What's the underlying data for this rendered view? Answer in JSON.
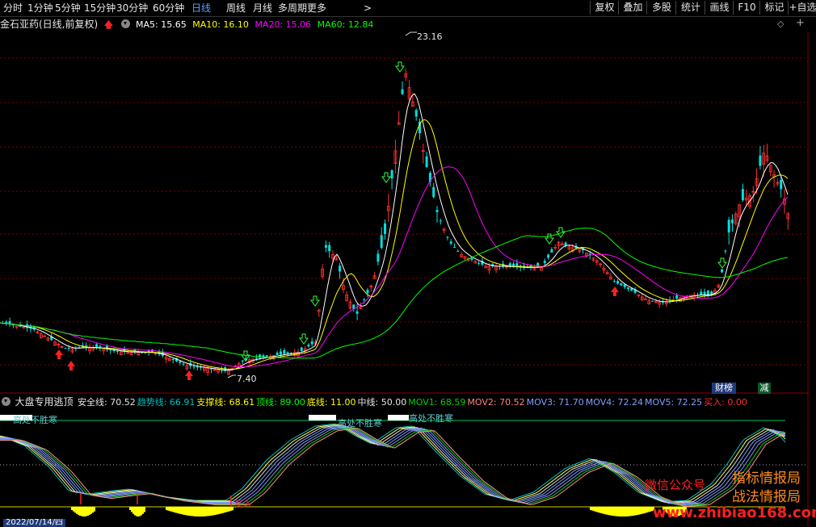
{
  "toolbar": {
    "tabs": [
      "分时",
      "1分钟",
      "5分钟",
      "15分钟",
      "30分钟",
      "60分钟",
      "日线",
      "周线",
      "月线",
      "多周期",
      "更多"
    ],
    "active_tab": "日线",
    "more_arrow": ">",
    "right_buttons": [
      "复权",
      "叠加",
      "多股",
      "统计",
      "画线",
      "F10",
      "标记",
      "+自选"
    ]
  },
  "main_chart": {
    "title": "金石亚药(日线,前复权)",
    "ma": [
      {
        "label": "MA5: 15.65",
        "color": "#ffffff"
      },
      {
        "label": "MA10: 16.10",
        "color": "#ffff00"
      },
      {
        "label": "MA20: 15.06",
        "color": "#ff00ff"
      },
      {
        "label": "MA60: 12.84",
        "color": "#00ff00"
      }
    ],
    "high_label": "23.16",
    "low_label": "7.40",
    "badge_left": "财榜",
    "badge_right": "减"
  },
  "indicator": {
    "title": "大盘专用逃顶",
    "values": [
      {
        "label": "安全线: 70.52",
        "color": "#e6e6e6"
      },
      {
        "label": "趋势线: 66.91",
        "color": "#00bfbf"
      },
      {
        "label": "支撑线: 68.61",
        "color": "#ffff00"
      },
      {
        "label": "顶线: 89.00",
        "color": "#00ff00"
      },
      {
        "label": "底线: 11.00",
        "color": "#ffff00"
      },
      {
        "label": "中线: 50.00",
        "color": "#e6e6e6"
      },
      {
        "label": "MOV1: 68.59",
        "color": "#00d000"
      },
      {
        "label": "MOV2: 70.52",
        "color": "#ff8080"
      },
      {
        "label": "MOV3: 71.70",
        "color": "#7fa0ff"
      },
      {
        "label": "MOV4: 72.24",
        "color": "#7fa0ff"
      },
      {
        "label": "MOV5: 72.25",
        "color": "#7fa0ff"
      },
      {
        "label": "买入: 0.00",
        "color": "#ff3030"
      }
    ],
    "top_signal": "高处不胜寒",
    "buy_signal": "买入"
  },
  "bottom": {
    "date": "2022/07/14/四"
  },
  "watermark": {
    "line1": "微信公众号",
    "brand1": "指标情报局",
    "brand2": "战法情报局",
    "url": "www.zhibiao168.com"
  }
}
